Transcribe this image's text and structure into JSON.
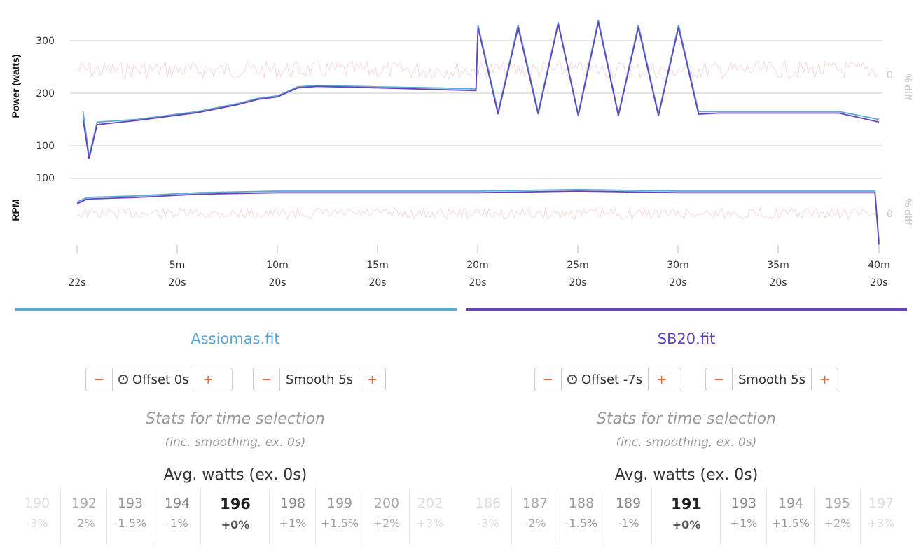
{
  "chart": {
    "y_axis_top_label": "Power (watts)",
    "y_axis_bottom_label": "RPM",
    "right_axis_label": "% diff",
    "right_zero_label": "0",
    "power_ticks": [
      "300",
      "200",
      "100"
    ],
    "rpm_ticks": [
      "100"
    ],
    "x_ticks": [
      {
        "top": "",
        "bottom": "22s"
      },
      {
        "top": "5m",
        "bottom": "20s"
      },
      {
        "top": "10m",
        "bottom": "20s"
      },
      {
        "top": "15m",
        "bottom": "20s"
      },
      {
        "top": "20m",
        "bottom": "20s"
      },
      {
        "top": "25m",
        "bottom": "20s"
      },
      {
        "top": "30m",
        "bottom": "20s"
      },
      {
        "top": "35m",
        "bottom": "20s"
      },
      {
        "top": "40m",
        "bottom": "20s"
      }
    ],
    "colors": {
      "file1": "#5ba7d6",
      "file2": "#6644b8",
      "diff": "#f0a8a8"
    }
  },
  "chart_data": {
    "type": "line",
    "x_unit": "minutes",
    "power": {
      "ylim": [
        80,
        350
      ],
      "series": [
        {
          "name": "Assiomas.fit",
          "x": [
            0.3,
            0.6,
            1,
            3,
            6,
            8,
            9,
            10,
            11,
            12,
            15,
            18,
            19.9,
            20,
            21,
            22,
            23,
            24,
            25,
            26,
            27,
            28,
            29,
            30,
            31,
            32,
            35,
            38,
            40
          ],
          "values": [
            165,
            80,
            145,
            150,
            165,
            180,
            190,
            195,
            212,
            215,
            212,
            210,
            208,
            330,
            165,
            330,
            165,
            335,
            160,
            340,
            160,
            330,
            160,
            330,
            165,
            165,
            165,
            165,
            150
          ]
        },
        {
          "name": "SB20.fit",
          "x": [
            0.3,
            0.6,
            1,
            3,
            6,
            8,
            9,
            10,
            11,
            12,
            15,
            18,
            19.9,
            20,
            21,
            22,
            23,
            24,
            25,
            26,
            27,
            28,
            29,
            30,
            31,
            32,
            35,
            38,
            40
          ],
          "values": [
            150,
            75,
            140,
            148,
            163,
            178,
            188,
            193,
            210,
            213,
            210,
            207,
            205,
            325,
            160,
            325,
            160,
            332,
            157,
            335,
            157,
            325,
            157,
            325,
            160,
            162,
            162,
            162,
            145
          ]
        }
      ]
    },
    "rpm": {
      "ylim": [
        60,
        100
      ],
      "series": [
        {
          "name": "Assiomas.fit",
          "x": [
            0,
            0.5,
            3,
            6,
            10,
            15,
            20,
            25,
            30,
            35,
            39.8,
            40
          ],
          "values": [
            85,
            88,
            89,
            91,
            92,
            92,
            92,
            93,
            92,
            92,
            92,
            60
          ]
        },
        {
          "name": "SB20.fit",
          "x": [
            0,
            0.5,
            3,
            6,
            10,
            15,
            20,
            25,
            30,
            35,
            39.8,
            40
          ],
          "values": [
            84,
            87,
            88,
            90,
            91,
            91,
            91,
            92,
            91,
            91,
            91,
            58
          ]
        }
      ]
    },
    "xlim": [
      0,
      40
    ]
  },
  "panels": [
    {
      "file_name": "Assiomas.fit",
      "color": "#5ba7d6",
      "offset": {
        "minus": "−",
        "label": "Offset 0s",
        "plus": "+"
      },
      "smooth": {
        "minus": "−",
        "label": "Smooth 5s",
        "plus": "+"
      },
      "stats_title": "Stats for time selection",
      "stats_subtitle": "(inc. smoothing, ex. 0s)",
      "avg_title": "Avg. watts (ex. 0s)",
      "cells": [
        {
          "value": "190",
          "pct": "-3%"
        },
        {
          "value": "192",
          "pct": "-2%"
        },
        {
          "value": "193",
          "pct": "-1.5%"
        },
        {
          "value": "194",
          "pct": "-1%"
        },
        {
          "value": "196",
          "pct": "+0%"
        },
        {
          "value": "198",
          "pct": "+1%"
        },
        {
          "value": "199",
          "pct": "+1.5%"
        },
        {
          "value": "200",
          "pct": "+2%"
        },
        {
          "value": "202",
          "pct": "+3%"
        }
      ]
    },
    {
      "file_name": "SB20.fit",
      "color": "#6644b8",
      "offset": {
        "minus": "−",
        "label": "Offset -7s",
        "plus": "+"
      },
      "smooth": {
        "minus": "−",
        "label": "Smooth 5s",
        "plus": "+"
      },
      "stats_title": "Stats for time selection",
      "stats_subtitle": "(inc. smoothing, ex. 0s)",
      "avg_title": "Avg. watts (ex. 0s)",
      "cells": [
        {
          "value": "186",
          "pct": "-3%"
        },
        {
          "value": "187",
          "pct": "-2%"
        },
        {
          "value": "188",
          "pct": "-1.5%"
        },
        {
          "value": "189",
          "pct": "-1%"
        },
        {
          "value": "191",
          "pct": "+0%"
        },
        {
          "value": "193",
          "pct": "+1%"
        },
        {
          "value": "194",
          "pct": "+1.5%"
        },
        {
          "value": "195",
          "pct": "+2%"
        },
        {
          "value": "197",
          "pct": "+3%"
        }
      ]
    }
  ]
}
